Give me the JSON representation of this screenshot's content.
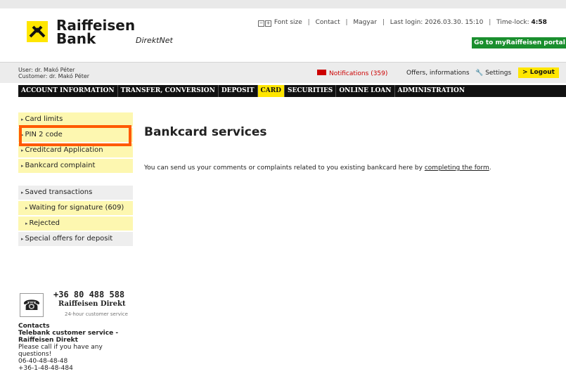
{
  "brand": {
    "name_line1": "Raiffeisen",
    "name_line2": "Bank",
    "app_name": "DirektNet"
  },
  "header": {
    "font_size_label": "Font size",
    "contact_label": "Contact",
    "language_label": "Magyar",
    "last_login": "Last login: 2026.03.30. 15:10",
    "time_lock_label": "Time-lock:",
    "time_lock_value": "4:58",
    "portal_button": "Go to myRaiffeisen portal"
  },
  "user": {
    "user_line": "User: dr. Makó Péter",
    "customer_line": "Customer: dr. Makó Péter",
    "notifications": "Notifications (359)",
    "offers": "Offers, informations",
    "settings": "Settings",
    "logout": "> Logout"
  },
  "nav": {
    "items": [
      "ACCOUNT INFORMATION",
      "TRANSFER, CONVERSION",
      "DEPOSIT",
      "CARD",
      "SECURITIES",
      "ONLINE LOAN",
      "ADMINISTRATION"
    ],
    "active": "CARD"
  },
  "sidebar": {
    "items": [
      "Card limits",
      "PIN 2 code",
      "Creditcard Application",
      "Bankcard complaint"
    ],
    "saved_transactions": "Saved transactions",
    "waiting": "Waiting for signature (609)",
    "rejected": "Rejected",
    "special_offers": "Special offers for deposit"
  },
  "phone": {
    "number": "+36 80 488 588",
    "name": "Raiffeisen Direkt",
    "sub": "24-hour customer service"
  },
  "contacts": {
    "heading": "Contacts",
    "service": "Telebank customer service - Raiffeisen Direkt",
    "text": "Please call if you have any questions!",
    "phone1": "06-40-48-48-48",
    "phone2": "+36-1-48-48-484"
  },
  "main": {
    "title": "Bankcard services",
    "text_before": "You can send us your comments or complaints related to you existing bankcard here by",
    "link": "completing the form",
    "text_after": "."
  },
  "colors": {
    "brand_yellow": "#ffe600",
    "nav_black": "#111111",
    "highlight_orange": "#ff5a00",
    "portal_green": "#1a8f2e",
    "notification_red": "#cc0000"
  }
}
